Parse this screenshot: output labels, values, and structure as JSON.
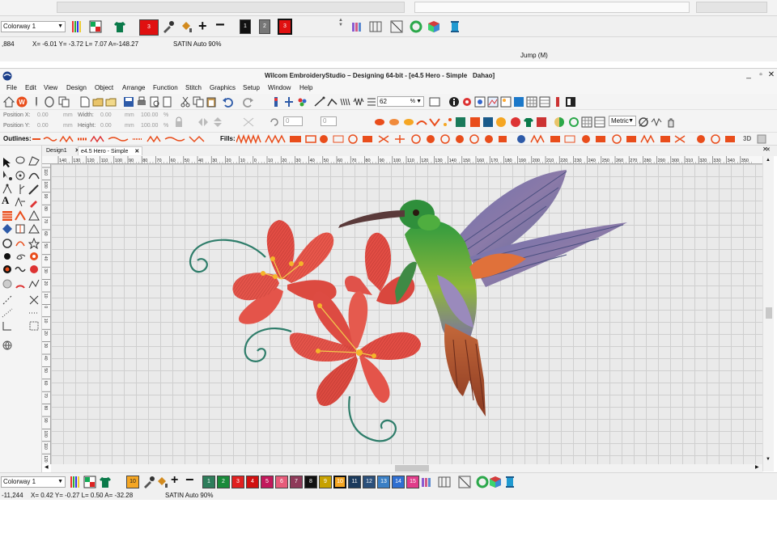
{
  "background_window": {
    "colorway": "Colorway 1",
    "swatches": [
      {
        "label": "3",
        "color": "#e01010"
      },
      {
        "label": "1",
        "color": "#111111"
      },
      {
        "label": "2",
        "color": "#777777"
      },
      {
        "label": "3",
        "color": "#e01010"
      }
    ],
    "status": {
      "left_value": ",884",
      "coords": "X=  -6.01 Y=   -3.72 L=   7.07 A=-148.27",
      "stitch": "SATIN Auto 90%",
      "jump": "Jump (M)"
    }
  },
  "window": {
    "title": "Wilcom EmbroideryStudio – Designing 64-bit - [e4.5 Hero - Simple",
    "user": "Dahao]",
    "controls": [
      "_",
      "▫",
      "✕"
    ]
  },
  "menu": [
    "File",
    "Edit",
    "View",
    "Design",
    "Object",
    "Arrange",
    "Function",
    "Stitch",
    "Graphics",
    "Setup",
    "Window",
    "Help"
  ],
  "toolbar": {
    "zoom_value": "62",
    "zoom_unit": "%",
    "units": "Metric"
  },
  "position_bar": {
    "pos_x_label": "Position X:",
    "pos_x_value": "0.00",
    "pos_y_label": "Position Y:",
    "pos_y_value": "0.00",
    "width_label": "Width:",
    "width_value": "0.00",
    "height_label": "Height:",
    "height_value": "0.00",
    "unit": "mm",
    "scale_w": "100.00",
    "scale_h": "100.00",
    "pct": "%",
    "rotate_value": "0",
    "slant_value": "0"
  },
  "stitch_bar": {
    "outlines_label": "Outlines:",
    "fills_label": "Fills:",
    "threed_label": "3D"
  },
  "tabs": [
    {
      "label": "Design1",
      "close": "✕"
    },
    {
      "label": "e4.5 Hero - Simple",
      "close": "✕"
    }
  ],
  "ruler": {
    "top": [
      "140",
      "130",
      "120",
      "110",
      "100",
      "90",
      "80",
      "70",
      "60",
      "50",
      "40",
      "30",
      "20",
      "10",
      "0",
      "10",
      "20",
      "30",
      "40",
      "50",
      "60",
      "70",
      "80",
      "90",
      "100",
      "110",
      "120",
      "130",
      "140",
      "150",
      "160",
      "170",
      "180",
      "190",
      "200",
      "210",
      "220",
      "230",
      "240",
      "250",
      "260",
      "270",
      "280",
      "290",
      "300",
      "310",
      "320",
      "330",
      "340",
      "350"
    ],
    "left": [
      "110",
      "100",
      "90",
      "80",
      "70",
      "60",
      "50",
      "40",
      "30",
      "20",
      "10",
      "0",
      "10",
      "20",
      "30",
      "40",
      "50",
      "60",
      "70",
      "80",
      "90",
      "100",
      "110",
      "120"
    ]
  },
  "bottom_toolbar": {
    "colorway": "Colorway 1",
    "current_color": {
      "label": "10",
      "color": "#f5a623"
    },
    "palette": [
      {
        "label": "1",
        "color": "#2e7d5b"
      },
      {
        "label": "2",
        "color": "#1a8a3a"
      },
      {
        "label": "3",
        "color": "#e02020"
      },
      {
        "label": "4",
        "color": "#d01010"
      },
      {
        "label": "5",
        "color": "#c2185b"
      },
      {
        "label": "6",
        "color": "#e65c7a"
      },
      {
        "label": "7",
        "color": "#8e3a59"
      },
      {
        "label": "8",
        "color": "#111111"
      },
      {
        "label": "9",
        "color": "#c7a100"
      },
      {
        "label": "10",
        "color": "#f5a623"
      },
      {
        "label": "11",
        "color": "#1b3a5c"
      },
      {
        "label": "12",
        "color": "#2a4f7a"
      },
      {
        "label": "13",
        "color": "#3a7fc4"
      },
      {
        "label": "14",
        "color": "#2f6fd1"
      },
      {
        "label": "15",
        "color": "#e03c8a"
      }
    ]
  },
  "status_bar": {
    "left_value": "-11,244",
    "coords": "X=   0.42 Y=  -0.27 L=   0.50 A=  -32.28",
    "stitch": "SATIN Auto 90%"
  },
  "colors": {
    "accent": "#e94d1b",
    "canvas": "#eaeaea"
  }
}
